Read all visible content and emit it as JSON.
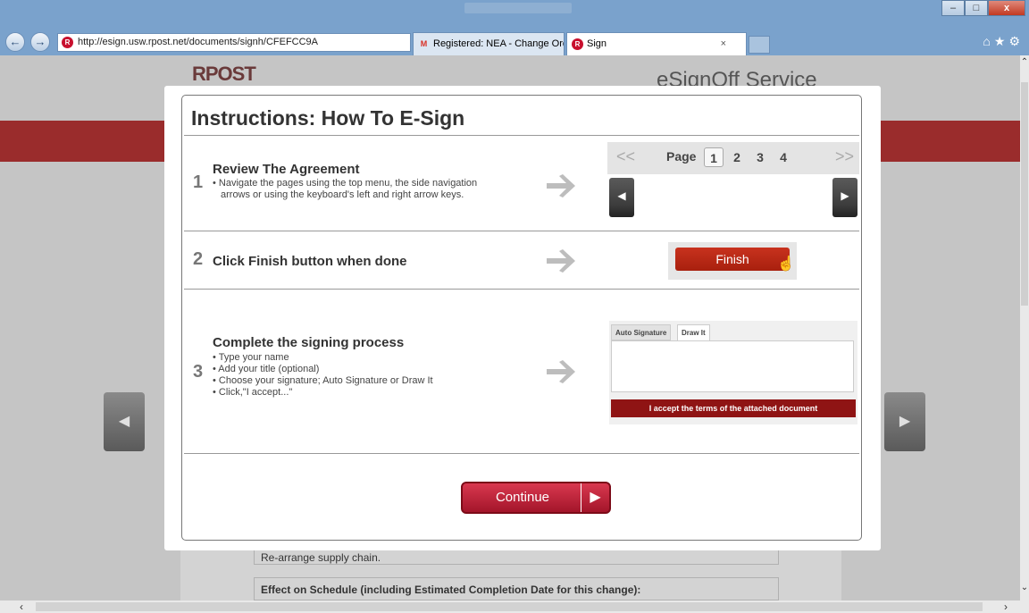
{
  "browser": {
    "address": "http://esign.usw.rpost.net/documents/signh/CFEFCC9A",
    "address_ctrls": "⌕ ▾ ↻",
    "tabs": [
      {
        "label": "Registered: NEA - Change Ord..."
      },
      {
        "label": "Sign"
      }
    ],
    "tab_close": "×",
    "window_buttons": [
      "–",
      "□",
      "x"
    ]
  },
  "page": {
    "logo": "RPOST",
    "service_title": "eSignOff Service",
    "rows": [
      {
        "text": "Re-arrange supply chain."
      },
      {
        "text": "Effect on Schedule (including Estimated Completion Date for this change):"
      }
    ]
  },
  "modal": {
    "title": "Instructions: How To E-Sign",
    "steps": [
      {
        "num": "1",
        "title": "Review The Agreement",
        "desc_lines": [
          "• Navigate the pages using the top menu, the side navigation",
          "arrows or using the keyboard's left and right arrow keys."
        ]
      },
      {
        "num": "2",
        "title": "Click Finish button when done"
      },
      {
        "num": "3",
        "title": "Complete the signing process",
        "desc_lines": [
          "• Type your name",
          "• Add your title (optional)",
          "• Choose your signature; Auto Signature or Draw It",
          "• Click,\"I accept...\""
        ]
      }
    ],
    "pager": {
      "first": "<<",
      "last": ">>",
      "label": "Page",
      "pages": [
        "1",
        "2",
        "3",
        "4"
      ],
      "active_page": "1"
    },
    "finish_label": "Finish",
    "signature": {
      "tab_auto": "Auto Signature",
      "tab_draw": "Draw It",
      "accept_label": "I accept the terms of the attached document"
    },
    "continue_label": "Continue"
  },
  "colors": {
    "accent_red": "#c8321e",
    "accept_red": "#8f1414",
    "continue_red": "#d9384f"
  }
}
